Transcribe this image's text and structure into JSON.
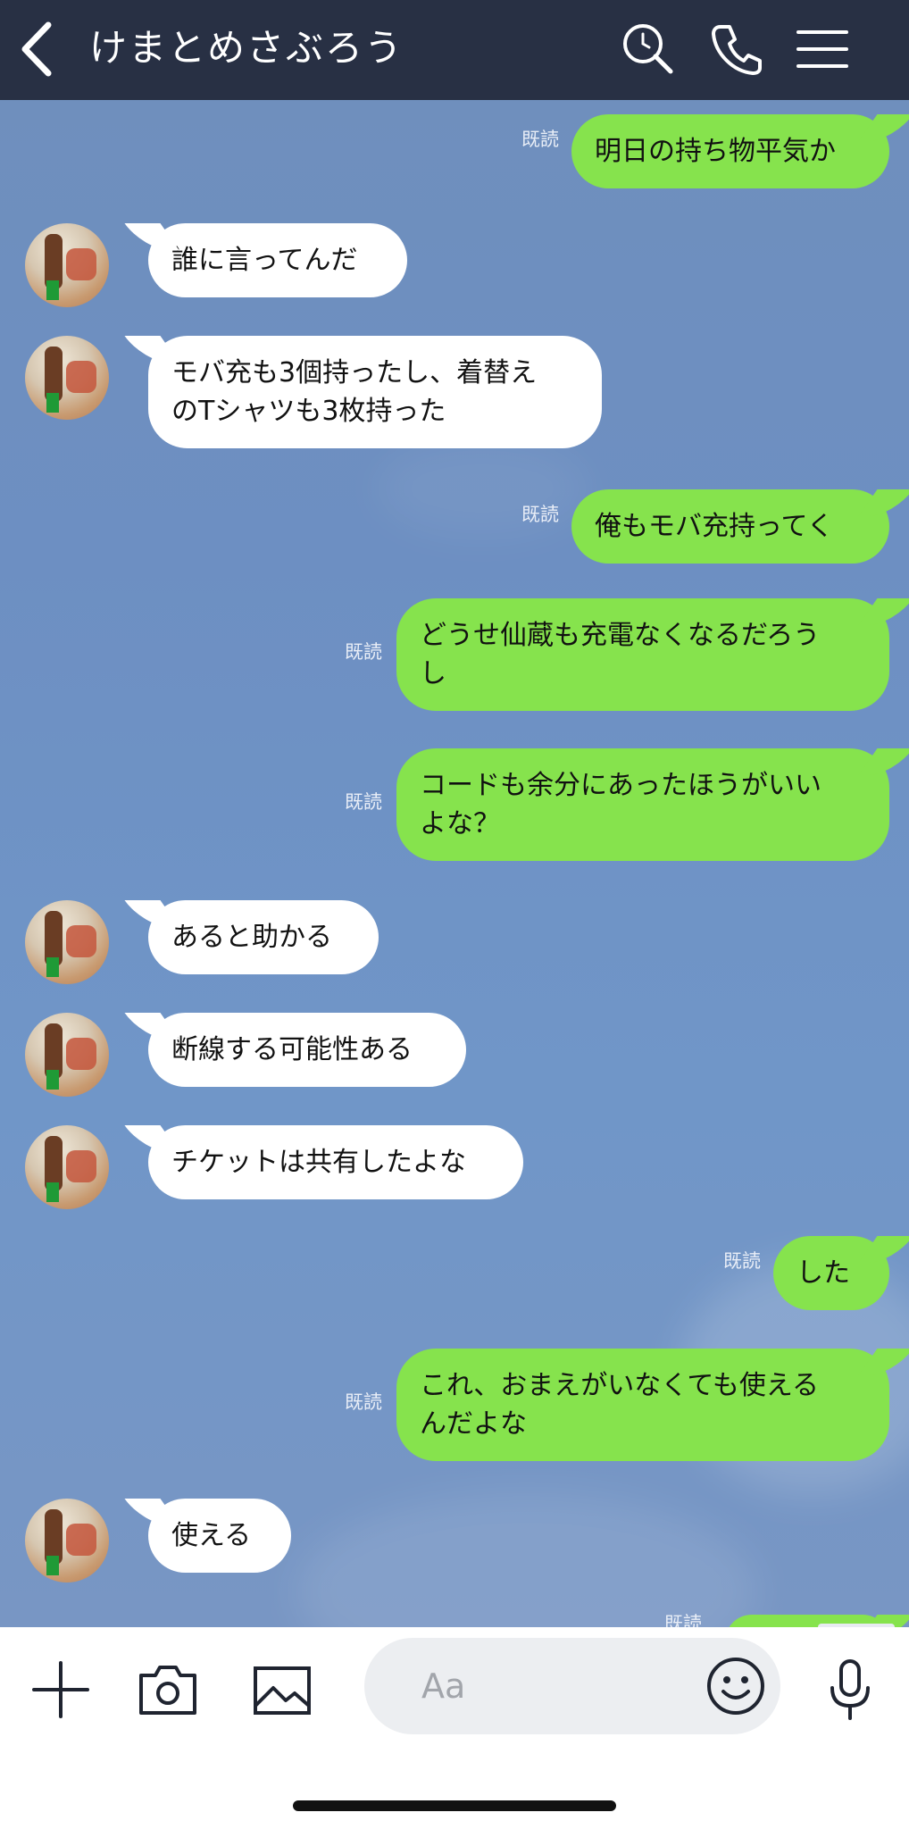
{
  "header": {
    "title": "けまとめさぶろう"
  },
  "read_label": "既読",
  "messages": [
    {
      "side": "out",
      "text": "明日の持ち物平気か",
      "read": "既読"
    },
    {
      "side": "in",
      "text": "誰に言ってんだ"
    },
    {
      "side": "in",
      "text": "モバ充も3個持ったし、着替え\nのTシャツも3枚持った"
    },
    {
      "side": "out",
      "text": "俺もモバ充持ってく",
      "read": "既読"
    },
    {
      "side": "out",
      "text": "どうせ仙蔵も充電なくなるだろう\nし",
      "read": "既読"
    },
    {
      "side": "out",
      "text": "コードも余分にあったほうがいい\nよな？",
      "read": "既読"
    },
    {
      "side": "in",
      "text": "あると助かる"
    },
    {
      "side": "in",
      "text": "断線する可能性ある"
    },
    {
      "side": "in",
      "text": "チケットは共有したよな"
    },
    {
      "side": "out",
      "text": "した",
      "read": "既読"
    },
    {
      "side": "out",
      "text": "これ、おまえがいなくても使える\nんだよな",
      "read": "既読"
    },
    {
      "side": "in",
      "text": "使える"
    }
  ],
  "input": {
    "placeholder": "Aa"
  },
  "icons": {
    "header": [
      "chevron-left-icon",
      "search-icon",
      "phone-icon",
      "menu-icon"
    ],
    "input": [
      "plus-icon",
      "camera-icon",
      "image-icon",
      "emoji-icon",
      "microphone-icon"
    ],
    "scroll": "arrow-down-icon"
  },
  "colors": {
    "header_bg": "#283044",
    "chat_bg": "#6f8fbd",
    "outgoing_bubble": "#86e34d",
    "incoming_bubble": "#ffffff"
  }
}
